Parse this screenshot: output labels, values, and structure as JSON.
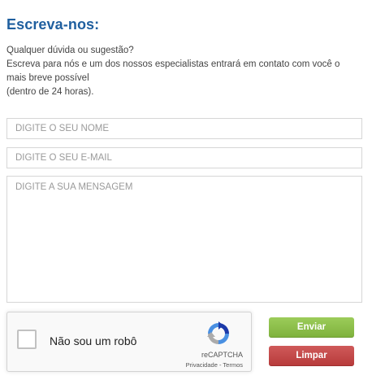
{
  "contact": {
    "title": "Escreva-nos:",
    "intro_lines": [
      "Qualquer dúvida ou sugestão?",
      "Escreva para nós e um dos nossos especialistas entrará em contato com você o",
      "mais breve possível",
      "(dentro de 24 horas)."
    ]
  },
  "form": {
    "name_placeholder": "DIGITE O SEU NOME",
    "email_placeholder": "DIGITE O SEU E-MAIL",
    "message_placeholder": "DIGITE A SUA MENSAGEM",
    "send_label": "Enviar",
    "clear_label": "Limpar"
  },
  "recaptcha": {
    "label": "Não sou um robô",
    "brand": "reCAPTCHA",
    "privacy_link": "Privacidade",
    "separator": " - ",
    "terms_link": "Termos",
    "logo_icon": "recaptcha-logo-icon"
  },
  "colors": {
    "title": "#1f5f9f",
    "send_button": "#8cc04a",
    "clear_button": "#c44a4a"
  }
}
